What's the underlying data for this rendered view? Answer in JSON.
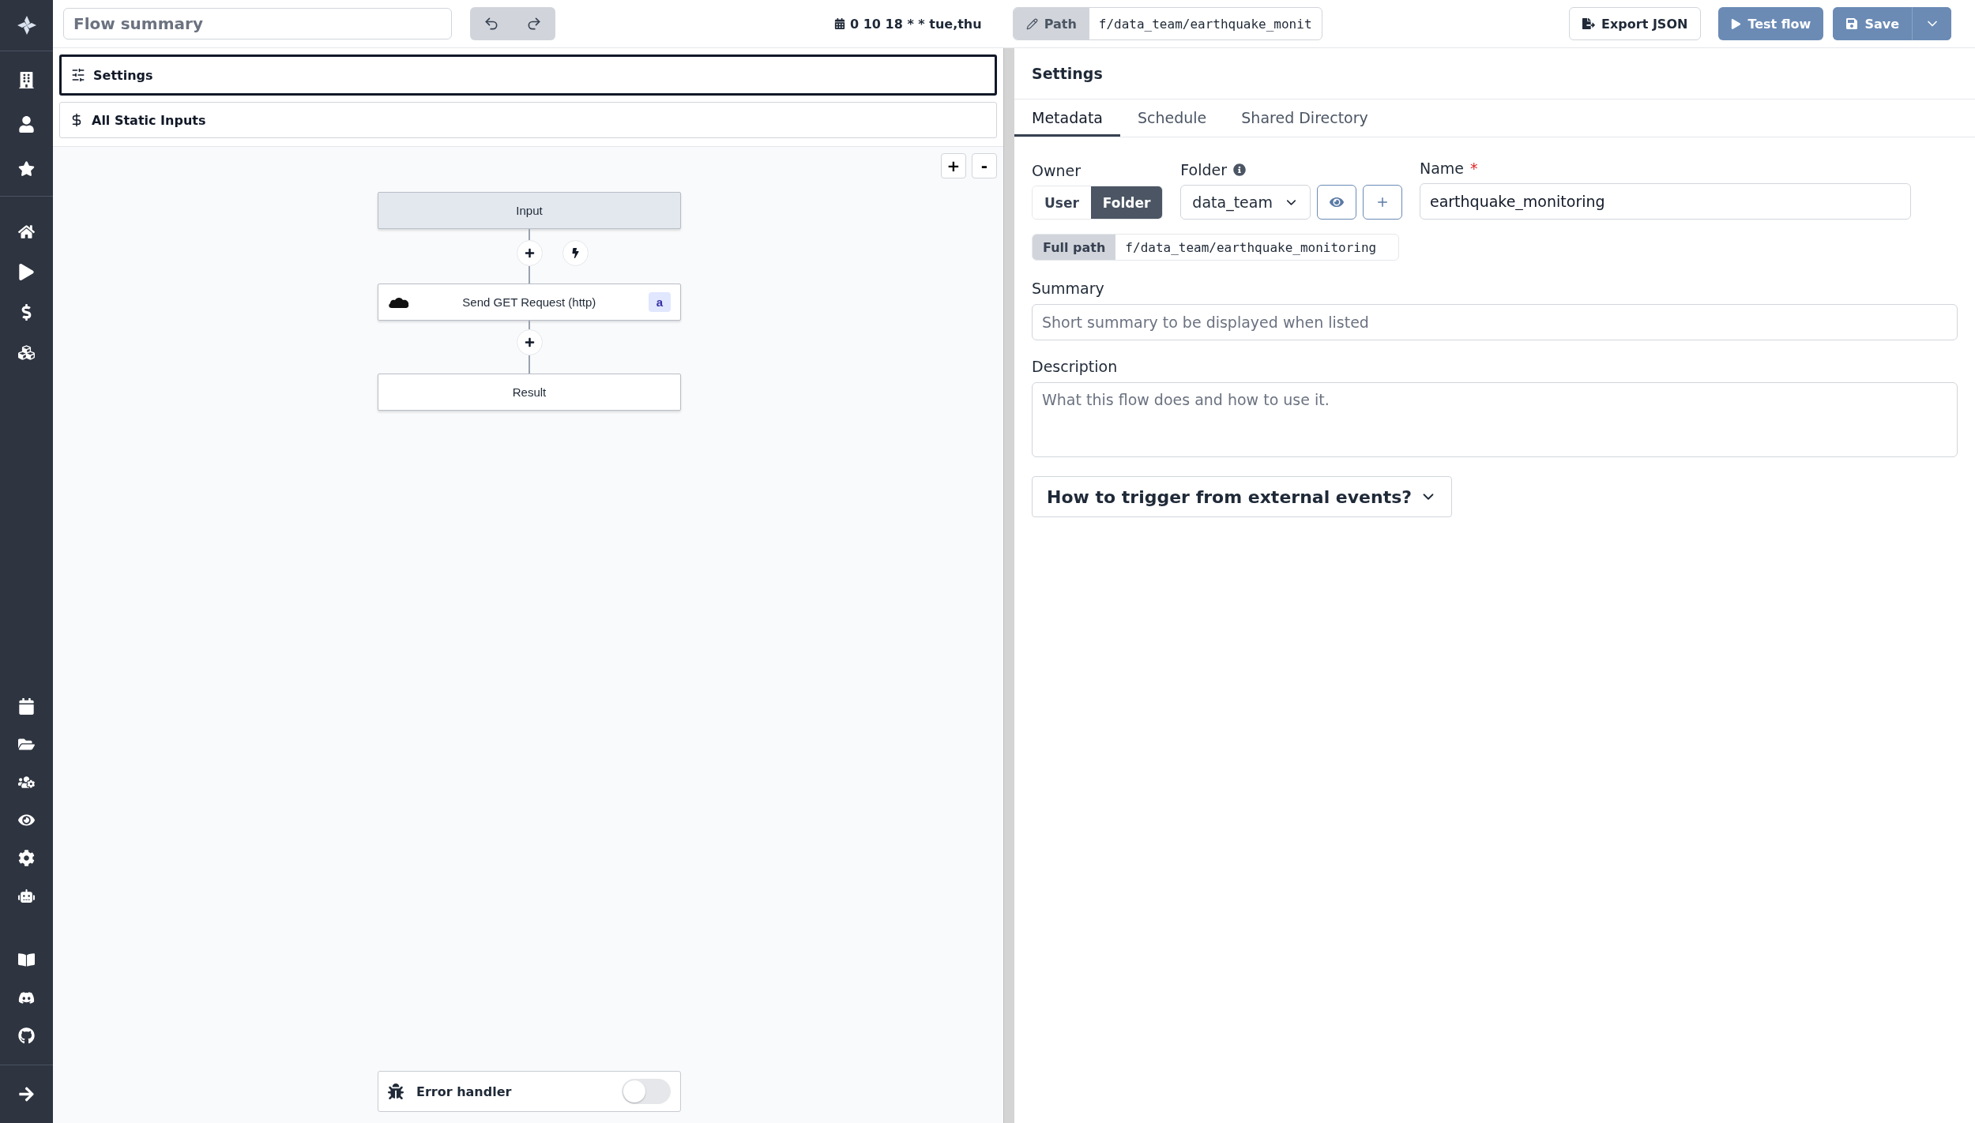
{
  "top_bar": {
    "flow_summary": {
      "placeholder": "Flow summary"
    },
    "schedule": "0 10 18 * * tue,thu",
    "path": {
      "label": "Path",
      "value": "f/data_team/earthquake_monit"
    },
    "buttons": [
      {
        "label": "Export JSON",
        "kind": "outline"
      },
      {
        "label": "Test flow",
        "kind": "primary"
      },
      {
        "label": "Save",
        "kind": "split"
      }
    ]
  },
  "left_panel": {
    "items": [
      {
        "label": "Settings",
        "kind": "settings",
        "selected": true
      },
      {
        "label": "All Static Inputs",
        "kind": "inputs",
        "selected": false
      }
    ],
    "zoom_buttons": [
      "+",
      "-"
    ],
    "nodes": [
      {
        "kind": "input",
        "label": "Input"
      },
      {
        "kind": "module",
        "label": "Send GET Request (http)",
        "badge": "a"
      },
      {
        "kind": "result",
        "label": "Result"
      }
    ],
    "error_handler": {
      "label": "Error handler",
      "on": false
    }
  },
  "right_panel": {
    "title": "Settings",
    "tabs": [
      {
        "label": "Metadata",
        "selected": true
      },
      {
        "label": "Schedule",
        "selected": false
      },
      {
        "label": "Shared Directory",
        "selected": false
      }
    ],
    "owner": {
      "label": "Owner",
      "options": [
        {
          "label": "User",
          "selected": false
        },
        {
          "label": "Folder",
          "selected": true
        }
      ]
    },
    "folder": {
      "label": "Folder",
      "value": "data_team"
    },
    "name": {
      "label": "Name",
      "required_mark": "*",
      "value": "earthquake_monitoring"
    },
    "full_path": {
      "label": "Full path",
      "value": "f/data_team/earthquake_monitoring"
    },
    "summary": {
      "label": "Summary",
      "placeholder": "Short summary to be displayed when listed"
    },
    "description": {
      "label": "Description",
      "placeholder": "What this flow does and how to use it."
    },
    "trigger_help": {
      "label": "How to trigger from external events?",
      "expanded": false
    }
  }
}
